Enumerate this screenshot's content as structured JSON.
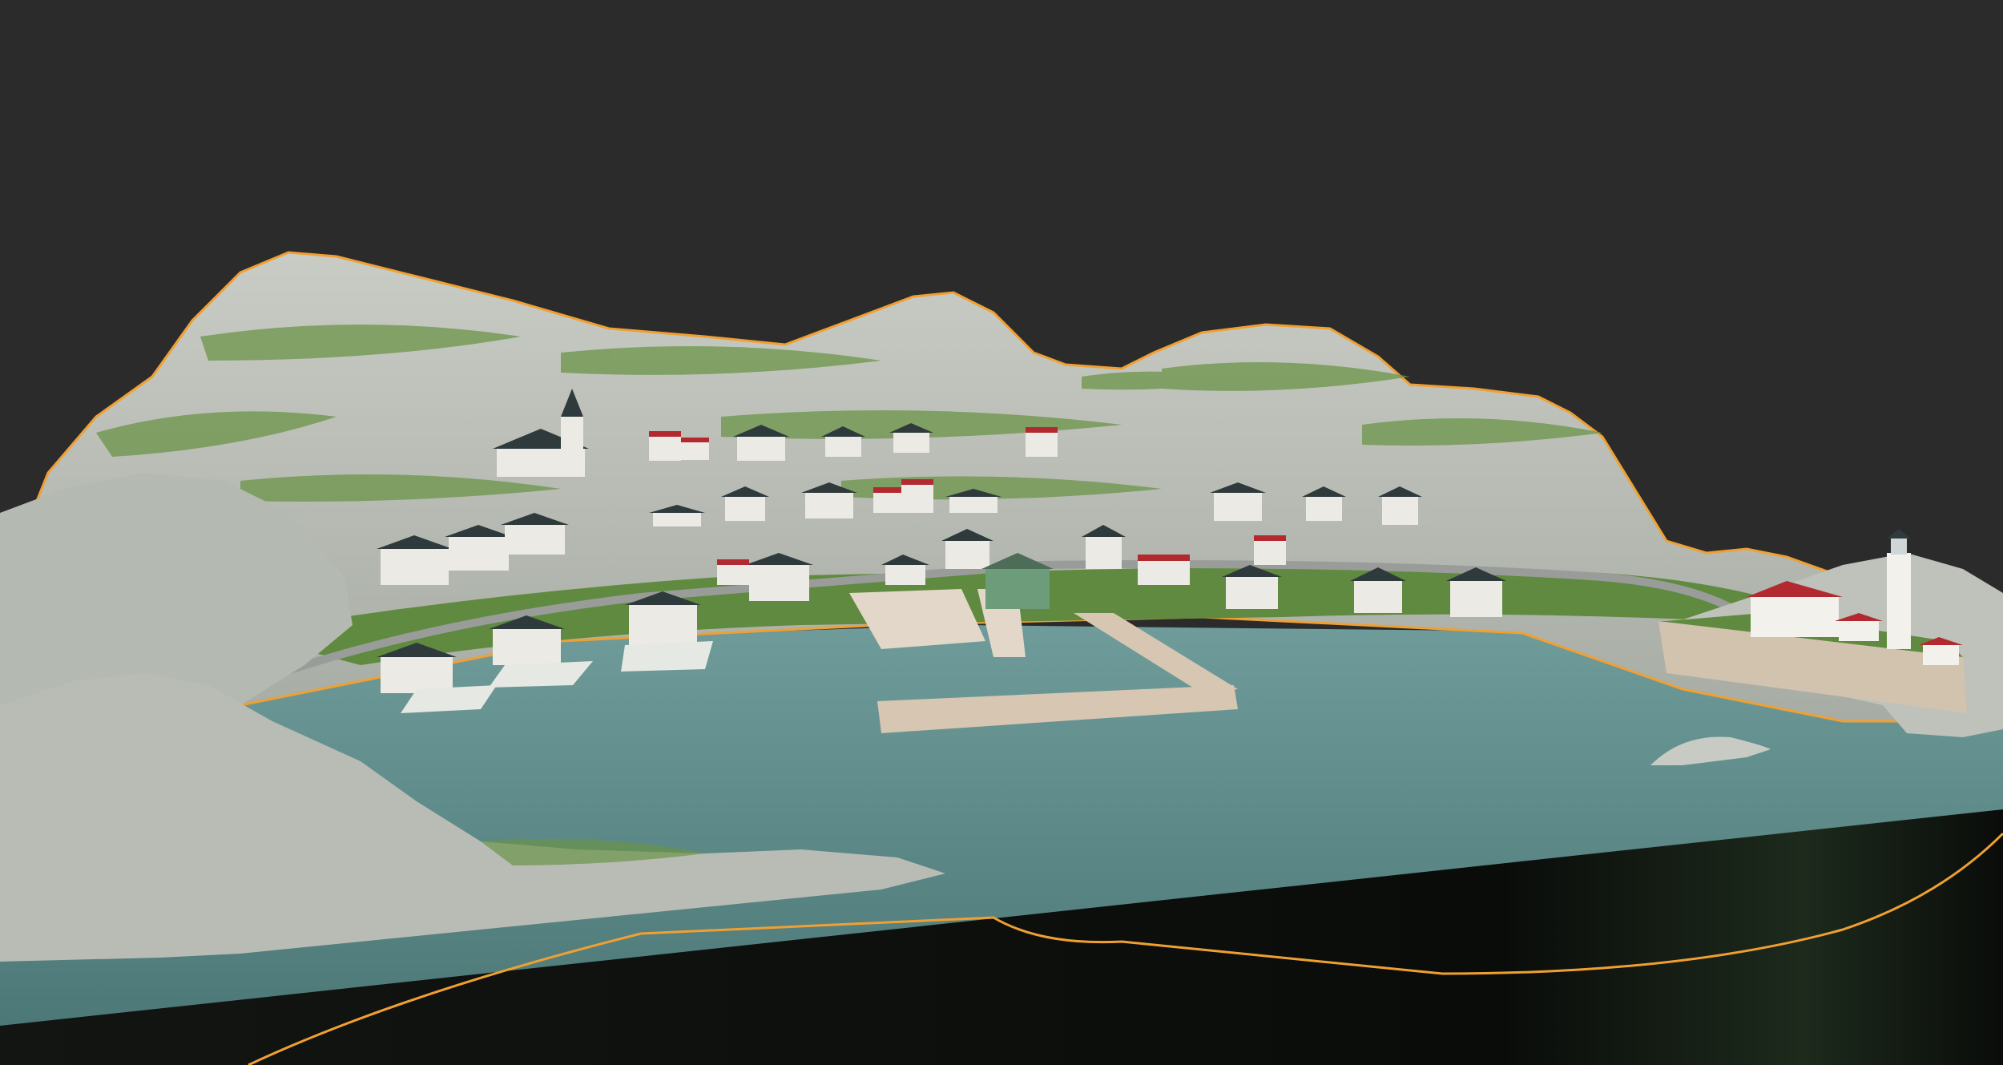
{
  "viewport": {
    "background": "#2b2b2b",
    "selection_outline_color": "#f0a032"
  },
  "scene": {
    "terrain_color": "#b9bdb6",
    "grass_color": "#5f8a3f",
    "water_color": "#5c8c8a",
    "base_side_color": "#0d0f0d",
    "roof_dark_color": "#2f3a3c",
    "roof_red_color": "#b22a30",
    "wall_color": "#eceae4",
    "pier_color": "#d6c6b2",
    "road_color": "#9a9c9a",
    "icons": [
      "church-icon",
      "lighthouse-icon",
      "house-icon",
      "pier-icon"
    ]
  }
}
